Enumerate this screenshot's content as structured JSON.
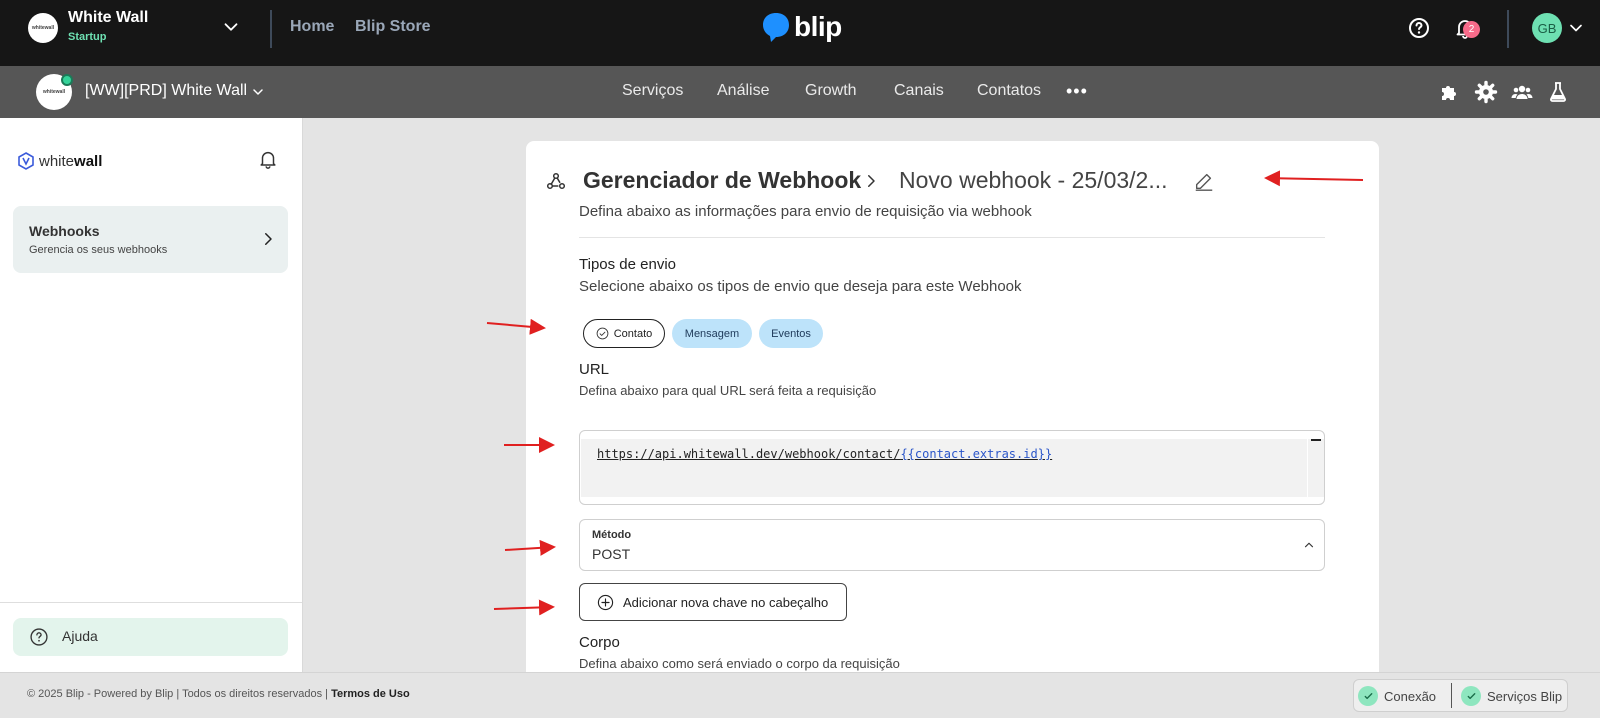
{
  "topbar": {
    "org_name": "White Wall",
    "org_plan": "Startup",
    "org_logo_text": "whitewall",
    "home_link": "Home",
    "store_link": "Blip Store",
    "brand": "blip",
    "notification_count": "2",
    "user_initials": "GB"
  },
  "subbar": {
    "bot_name": "[WW][PRD] White Wall",
    "bot_logo_text": "whitewall",
    "nav": [
      "Serviços",
      "Análise",
      "Growth",
      "Canais",
      "Contatos"
    ],
    "more": "•••"
  },
  "sidebar": {
    "logo_prefix": "white",
    "logo_suffix": "wall",
    "item_title": "Webhooks",
    "item_sub": "Gerencia os seus webhooks",
    "help_label": "Ajuda"
  },
  "main": {
    "breadcrumb_title": "Gerenciador de Webhook",
    "webhook_name": "Novo webhook - 25/03/2...",
    "subtitle": "Defina abaixo as informações para envio de requisição via webhook",
    "send_types_title": "Tipos de envio",
    "send_types_sub": "Selecione abaixo os tipos de envio que deseja para este Webhook",
    "chips": [
      "Contato",
      "Mensagem",
      "Eventos"
    ],
    "url_title": "URL",
    "url_sub": "Defina abaixo para qual URL será feita a requisição",
    "url_value_plain": "https://api.whitewall.dev/webhook/contact/",
    "url_value_var_open": "{{",
    "url_value_var": "contact.extras.id",
    "url_value_var_close": "}}",
    "method_label": "Método",
    "method_value": "POST",
    "add_header_label": "Adicionar nova chave no cabeçalho",
    "body_title": "Corpo",
    "body_sub": "Defina abaixo como será enviado o corpo da requisição"
  },
  "footer": {
    "copyright": "© 2025 Blip - Powered by Blip | Todos os direitos reservados |",
    "terms": "Termos de Uso",
    "status_connection": "Conexão",
    "status_services": "Serviços Blip"
  },
  "colors": {
    "topbar_bg": "#161616",
    "subbar_bg": "#565656",
    "accent_green": "#6ee0b2",
    "brand_blue": "#1e90ff",
    "chip_blue": "#bde3fa",
    "annotation_red": "#e02020",
    "badge_pink": "#f76b8a"
  },
  "icons": [
    "chevron-down-icon",
    "help-icon",
    "bell-icon",
    "puzzle-icon",
    "gear-icon",
    "users-icon",
    "flask-icon",
    "webhook-icon",
    "chevron-right-icon",
    "pencil-icon",
    "check-circle-icon",
    "plus-circle-icon",
    "chevron-up-icon",
    "check-icon",
    "help-circle-icon"
  ]
}
